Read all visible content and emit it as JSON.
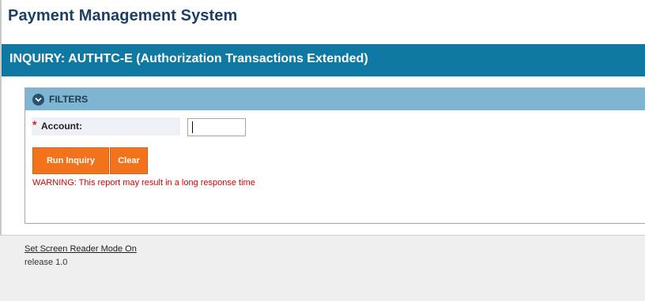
{
  "app": {
    "title": "Payment Management System"
  },
  "page": {
    "heading": "INQUIRY: AUTHTC-E (Authorization Transactions Extended)"
  },
  "filters": {
    "header_label": "FILTERS",
    "header_icon": "chevron-down-circle-icon",
    "account": {
      "required_marker": "*",
      "label": "Account:",
      "value": "",
      "placeholder": ""
    },
    "buttons": {
      "run_label": "Run Inquiry",
      "clear_label": "Clear"
    },
    "warning": "WARNING: This report may result in a long response time"
  },
  "footer": {
    "screen_reader_link": "Set Screen Reader Mode On",
    "release": "release 1.0"
  },
  "colors": {
    "banner": "#1079a3",
    "filters_header": "#7db5d2",
    "button": "#f2731c",
    "warning": "#d40000",
    "title": "#1c3f66"
  }
}
